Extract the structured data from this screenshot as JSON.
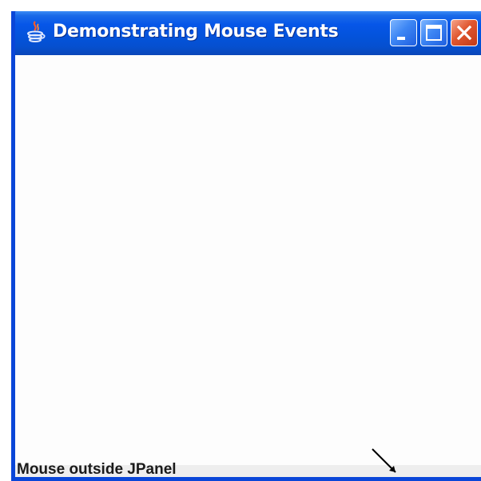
{
  "window": {
    "title": "Demonstrating Mouse Events",
    "icon": "java-icon",
    "controls": {
      "minimize": "minimize-icon",
      "maximize": "maximize-icon",
      "close": "close-icon"
    }
  },
  "status_bar": {
    "text": "Mouse outside JPanel"
  },
  "colors": {
    "title_bar": "#0656e8",
    "frame_border": "#0a46d8",
    "close_button": "#e0562e",
    "client_background": "#fdfdfd",
    "status_background": "#eeeeee"
  }
}
